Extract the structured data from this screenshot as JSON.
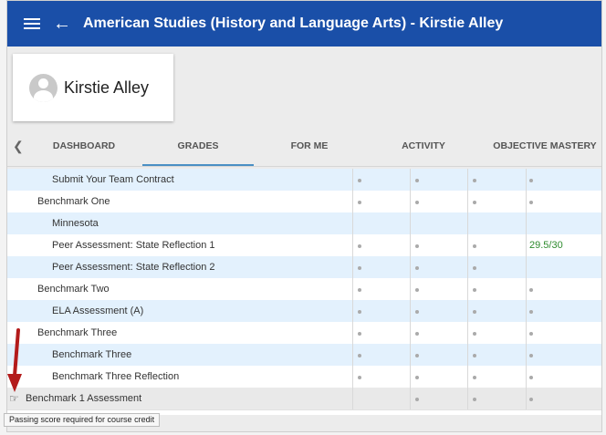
{
  "header": {
    "title": "American Studies (History and Language Arts) - Kirstie Alley",
    "menu_icon": "hamburger-menu-icon",
    "back_icon": "back-arrow-icon"
  },
  "profile": {
    "name": "Kirstie Alley"
  },
  "tabs": [
    {
      "label": "DASHBOARD"
    },
    {
      "label": "GRADES"
    },
    {
      "label": "FOR ME"
    },
    {
      "label": "ACTIVITY"
    },
    {
      "label": "OBJECTIVE MASTERY"
    }
  ],
  "rows": [
    {
      "label": "Submit Your Team Contract",
      "indent": 2,
      "style": "blue",
      "dots": [
        true,
        true,
        true,
        true
      ],
      "score": ""
    },
    {
      "label": "Benchmark One",
      "indent": 1,
      "style": "white",
      "dots": [
        true,
        true,
        true,
        true
      ],
      "score": ""
    },
    {
      "label": "Minnesota",
      "indent": 2,
      "style": "blue",
      "dots": [
        false,
        false,
        false,
        false
      ],
      "score": ""
    },
    {
      "label": "Peer Assessment: State Reflection 1",
      "indent": 2,
      "style": "white",
      "dots": [
        true,
        true,
        true,
        false
      ],
      "score": "29.5/30"
    },
    {
      "label": "Peer Assessment: State Reflection 2",
      "indent": 2,
      "style": "blue",
      "dots": [
        true,
        true,
        true,
        false
      ],
      "score": ""
    },
    {
      "label": "Benchmark Two",
      "indent": 1,
      "style": "white",
      "dots": [
        true,
        true,
        true,
        true
      ],
      "score": ""
    },
    {
      "label": "ELA Assessment (A)",
      "indent": 2,
      "style": "blue",
      "dots": [
        true,
        true,
        true,
        true
      ],
      "score": ""
    },
    {
      "label": "Benchmark Three",
      "indent": 1,
      "style": "white",
      "dots": [
        true,
        true,
        true,
        true
      ],
      "score": ""
    },
    {
      "label": "Benchmark Three",
      "indent": 2,
      "style": "blue",
      "dots": [
        true,
        true,
        true,
        true
      ],
      "score": ""
    },
    {
      "label": "Benchmark Three Reflection",
      "indent": 2,
      "style": "white",
      "dots": [
        true,
        true,
        true,
        true
      ],
      "score": ""
    },
    {
      "label": "Benchmark 1 Assessment",
      "indent": 0,
      "style": "gray",
      "dots": [
        false,
        true,
        true,
        true
      ],
      "score": "",
      "icon": "pointing-hand-icon"
    }
  ],
  "tooltip": "Passing score required for course credit",
  "colors": {
    "appbar": "#1a4fa8",
    "row_highlight": "#e3f1fd",
    "score": "#2e8b2e",
    "arrow": "#b31b1b"
  }
}
